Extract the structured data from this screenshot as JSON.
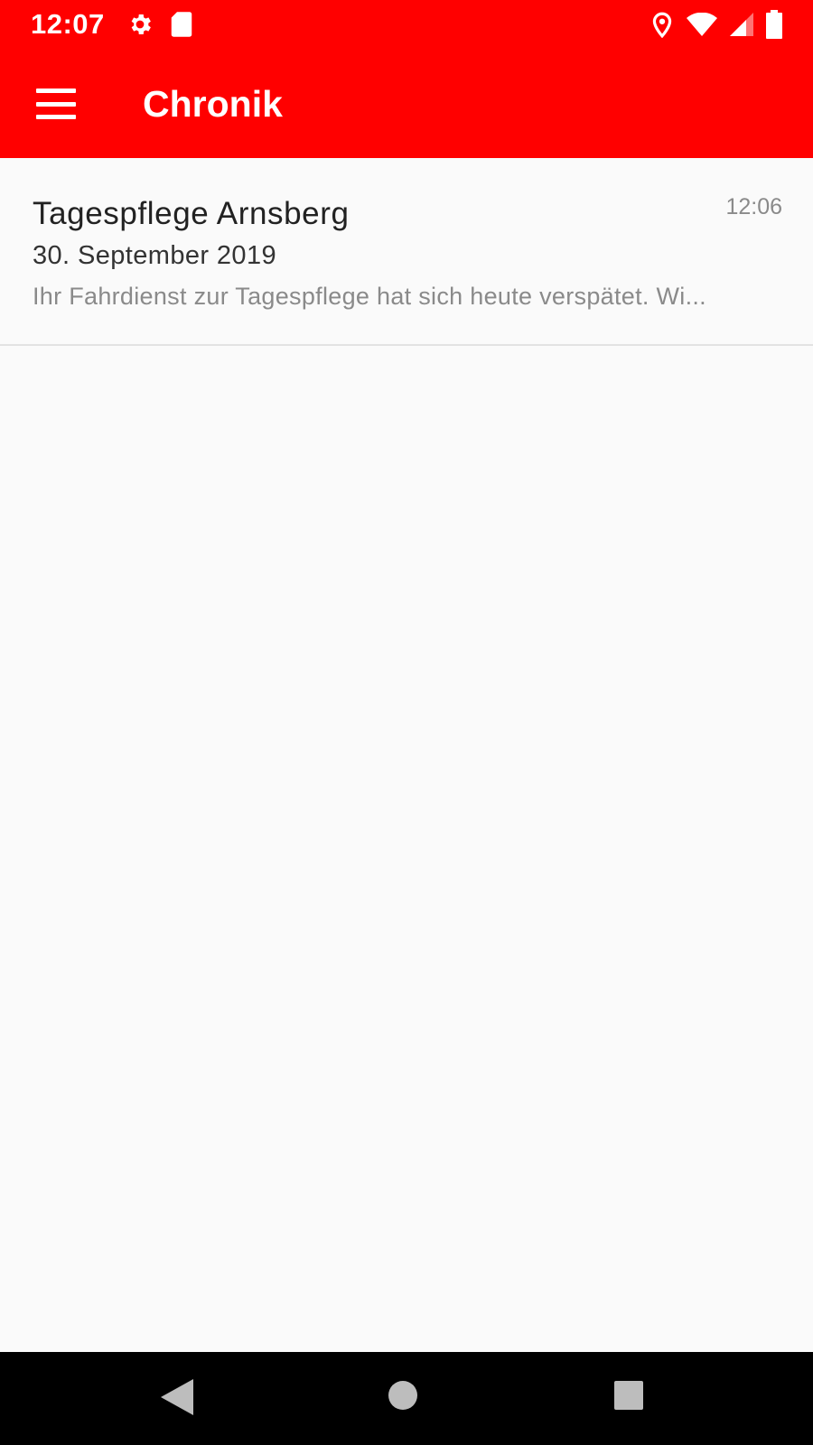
{
  "status_bar": {
    "time": "12:07",
    "left_icons": [
      "settings-icon",
      "sd-card-icon"
    ],
    "right_icons": [
      "location-icon",
      "wifi-icon",
      "cell-signal-icon",
      "battery-icon"
    ],
    "background": "#ff0000"
  },
  "app_bar": {
    "title": "Chronik",
    "menu_icon": "hamburger-menu-icon",
    "background": "#ff0000"
  },
  "messages": [
    {
      "title": "Tagespflege Arnsberg",
      "date": "30. September 2019",
      "preview": "Ihr Fahrdienst zur Tagespflege hat sich heute verspätet. Wi...",
      "time": "12:06"
    }
  ],
  "nav_bar": {
    "buttons": [
      "back-icon",
      "home-icon",
      "recents-icon"
    ]
  }
}
